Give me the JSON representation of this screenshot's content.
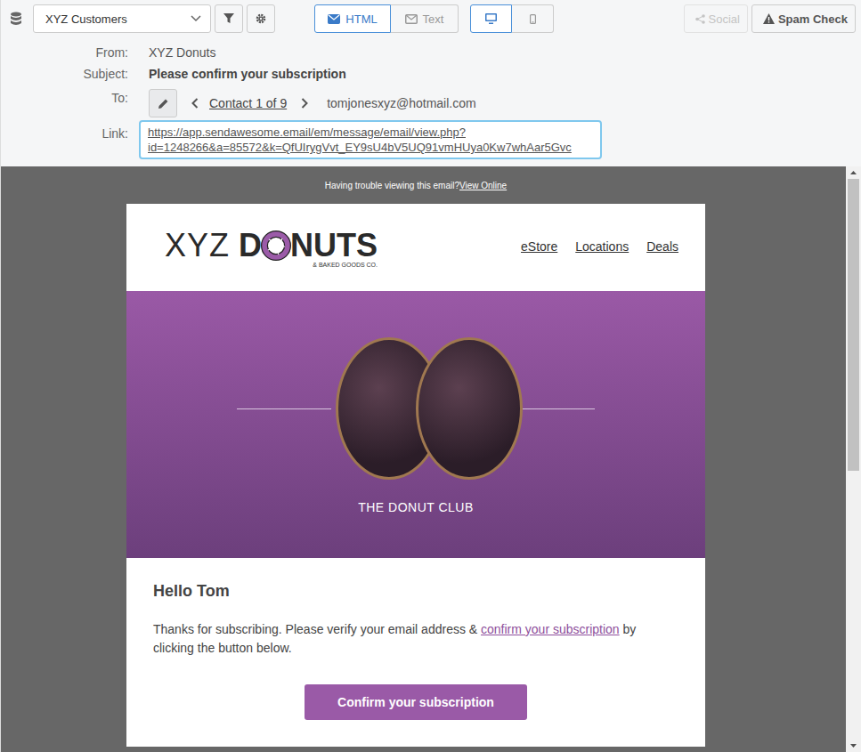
{
  "toolbar": {
    "list": {
      "value": "XYZ Customers"
    },
    "view_modes": [
      {
        "label": "HTML",
        "selected": true
      },
      {
        "label": "Text",
        "selected": false
      }
    ],
    "devices": [
      {
        "kind": "desktop",
        "selected": true
      },
      {
        "kind": "mobile",
        "selected": false
      }
    ],
    "buttons": [
      {
        "label": "Social",
        "disabled": true,
        "kind": "share"
      },
      {
        "label": "Spam Check",
        "disabled": false,
        "kind": "warning"
      }
    ]
  },
  "header": {
    "from_label": "From:",
    "from": "XYZ Donuts",
    "subject_label": "Subject:",
    "subject": "Please confirm your subscription",
    "to_label": "To:",
    "contact": "Contact 1 of 9",
    "to": "tomjonesxyz@hotmail.com",
    "link_label": "Link:",
    "link": [
      "https://app.sendawesome.email/em/message/email/view.php?",
      "id=1248266&a=85572&k=QfUIrygVvt_EY9sU4bV5UQ91vmHUya0Kw7whAar5Gvc"
    ]
  },
  "email": {
    "preheader": {
      "text": "Having trouble viewing this email?",
      "link": "View Online"
    },
    "logo": {
      "prefix": "XYZ",
      "start": "D",
      "end": "NUTS",
      "tagline": "& BAKED GOODS CO."
    },
    "nav": [
      "eStore",
      "Locations",
      "Deals"
    ],
    "hero": {
      "title": "THE DONUT CLUB"
    },
    "greeting": "Hello Tom",
    "body": {
      "before": "Thanks for subscribing. Please verify your email address & ",
      "link": "confirm your subscription",
      "after": " by clicking the button below."
    },
    "button": "Confirm your subscription"
  },
  "scrollbar": {
    "thumb_share": 0.52,
    "offset": 0
  }
}
